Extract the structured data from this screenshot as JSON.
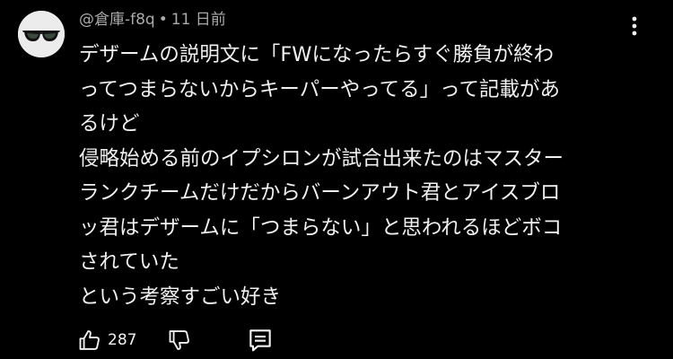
{
  "comment": {
    "author": "@倉庫-f8q",
    "separator": "•",
    "timestamp": "11 日前",
    "text_lines": [
      "デザームの説明文に「FWになったらすぐ勝負が終わ",
      "ってつまらないからキーパーやってる」って記載があ",
      "るけど",
      "侵略始める前のイプシロンが試合出来たのはマスター",
      "ランクチームだけだからバーンアウト君とアイスブロ",
      "ッ君はデザームに「つまらない」と思われるほどボコ",
      "されていた",
      "という考察すごい好き"
    ],
    "like_count": "287"
  },
  "icons": {
    "avatar": "sunglasses-avatar",
    "menu": "more-vertical-icon",
    "like": "thumbs-up-icon",
    "dislike": "thumbs-down-icon",
    "reply": "reply-comment-icon"
  },
  "colors": {
    "background": "#000000",
    "text": "#f1f1f1",
    "meta_text": "#aaaaaa"
  }
}
